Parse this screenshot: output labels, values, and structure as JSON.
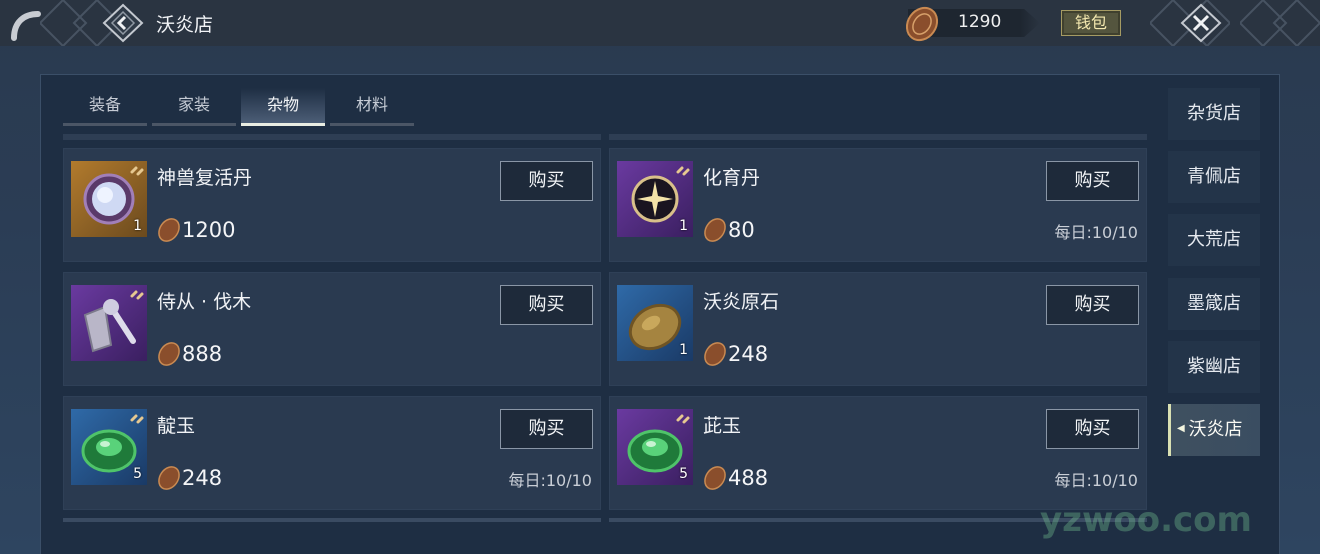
{
  "header": {
    "title": "沃炎店",
    "currency_amount": "1290",
    "wallet_label": "钱包"
  },
  "tabs": [
    {
      "label": "装备",
      "active": false
    },
    {
      "label": "家装",
      "active": false
    },
    {
      "label": "杂物",
      "active": true
    },
    {
      "label": "材料",
      "active": false
    }
  ],
  "items": [
    {
      "name": "神兽复活丹",
      "price": "1200",
      "qty": "1",
      "buy_label": "购买",
      "limit": "",
      "icon": "spirit-orb-icon"
    },
    {
      "name": "化育丹",
      "price": "80",
      "qty": "1",
      "buy_label": "购买",
      "limit": "每日:10/10",
      "icon": "star-pill-icon"
    },
    {
      "name": "侍从 · 伐木",
      "price": "888",
      "qty": "",
      "buy_label": "购买",
      "limit": "",
      "icon": "woodcutter-icon"
    },
    {
      "name": "沃炎原石",
      "price": "248",
      "qty": "1",
      "buy_label": "购买",
      "limit": "",
      "icon": "ore-stone-icon"
    },
    {
      "name": "靛玉",
      "price": "248",
      "qty": "5",
      "buy_label": "购买",
      "limit": "每日:10/10",
      "icon": "jade-icon"
    },
    {
      "name": "茈玉",
      "price": "488",
      "qty": "5",
      "buy_label": "购买",
      "limit": "每日:10/10",
      "icon": "jade-icon"
    }
  ],
  "sidebar": [
    {
      "label": "杂货店",
      "active": false
    },
    {
      "label": "青佩店",
      "active": false
    },
    {
      "label": "大荒店",
      "active": false
    },
    {
      "label": "墨箴店",
      "active": false
    },
    {
      "label": "紫幽店",
      "active": false
    },
    {
      "label": "沃炎店",
      "active": true
    }
  ],
  "watermark": "yzwoo.com"
}
